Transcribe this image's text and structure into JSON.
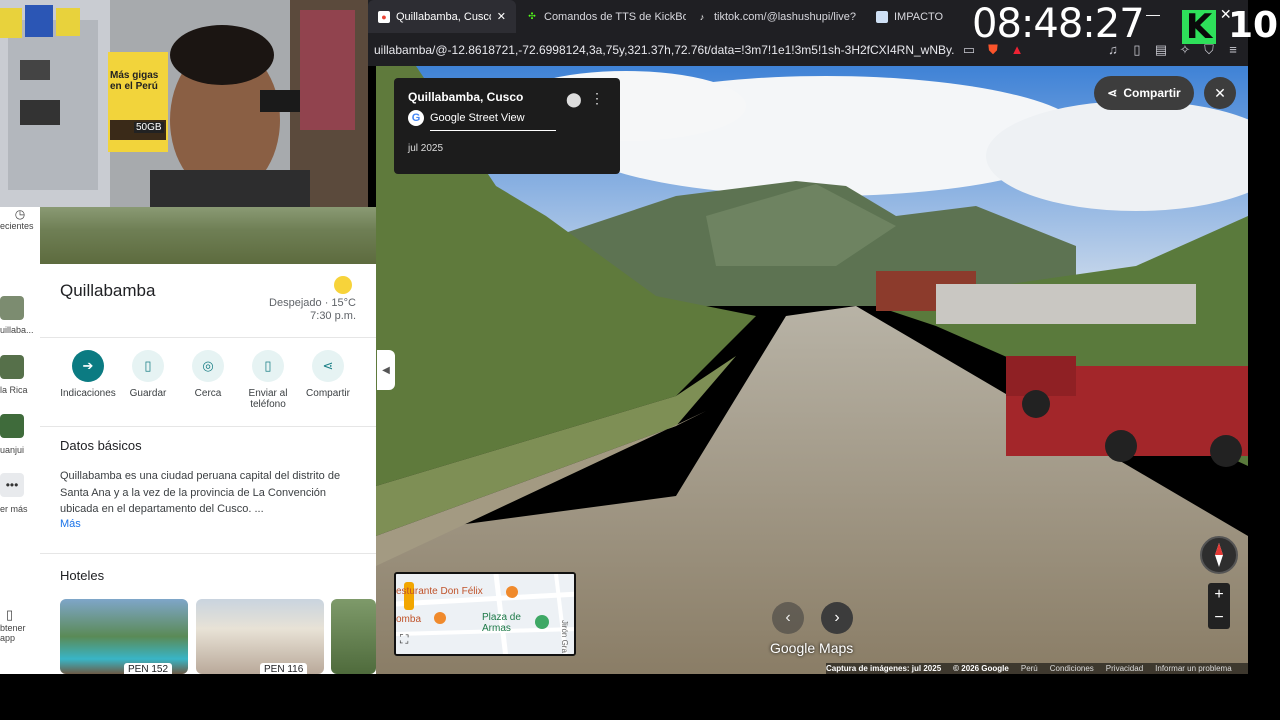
{
  "browser": {
    "tabs": [
      {
        "label": "Quillabamba, Cusco - Google Maps",
        "icon": "google-maps-icon",
        "active": true
      },
      {
        "label": "Comandos de TTS de KickBot",
        "icon": "kickbot-icon",
        "active": false
      },
      {
        "label": "tiktok.com/@lashushupi/live?e",
        "icon": "tiktok-icon",
        "active": false
      },
      {
        "label": "IMPACTO",
        "icon": "page-icon",
        "active": false
      }
    ],
    "url": "uillabamba/@-12.8618721,-72.6998124,3a,75y,321.37h,72.76t/data=!3m7!1e1!3m5!1sh-3H2fCXI4RN_wNBy..."
  },
  "overlay": {
    "clock": "08:48:27",
    "kick_letter": "K",
    "kick_count": "10",
    "minimize": "—",
    "close": "✕"
  },
  "streetview": {
    "place": "Quillabamba, Cusco",
    "source": "Google Street View",
    "date": "jul 2025",
    "share_label": "Compartir",
    "brand": "Google Maps",
    "watermark": "© 2026 Google",
    "minimap": {
      "label1": "esturante Don Félix",
      "label2": "Plaza de Armas",
      "label3": "omba",
      "label4": "Jirón Gra"
    },
    "footer": {
      "capture": "Captura de imágenes: jul 2025",
      "copyright": "© 2026 Google",
      "country": "Perú",
      "terms": "Condiciones",
      "privacy": "Privacidad",
      "report": "Informar un problema"
    }
  },
  "leftbar": {
    "recent": "ecientes",
    "item1": "uillaba...",
    "item2": "la Rica",
    "item3": "uanjui",
    "more": "er más",
    "app": "btener app"
  },
  "panel": {
    "title": "Quillabamba",
    "weather": "Despejado · 15°C",
    "time": "7:30 p.m.",
    "actions": [
      "Indicaciones",
      "Guardar",
      "Cerca",
      "Enviar al teléfono",
      "Compartir"
    ],
    "basic_title": "Datos básicos",
    "basic_desc": "Quillabamba es una ciudad peruana capital del distrito de Santa Ana y a la vez de la provincia de La Convención ubicada en el departamento del Cusco. ...",
    "more": "Más",
    "hotels_title": "Hoteles",
    "hotel_prices": [
      "PEN 152",
      "PEN 116"
    ]
  },
  "colors": {
    "accent": "#0b7b82",
    "sky": "#4c8bd9",
    "kick": "#2ee05a"
  }
}
